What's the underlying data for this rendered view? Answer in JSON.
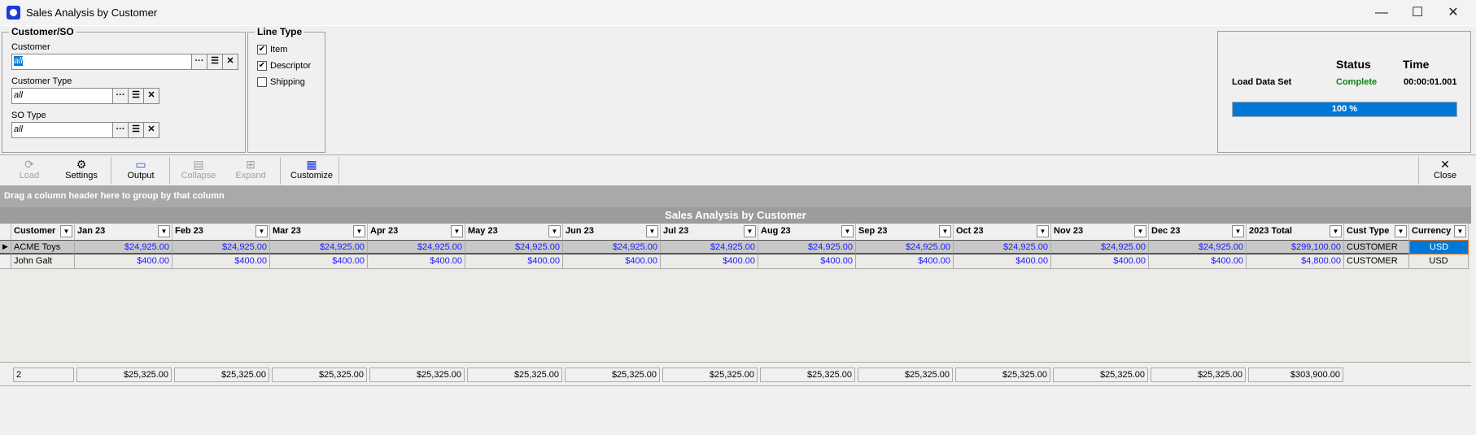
{
  "window": {
    "title": "Sales Analysis by Customer",
    "minimize": "—",
    "maximize": "☐",
    "close": "✕"
  },
  "filters": {
    "group_label": "Customer/SO",
    "customer": {
      "label": "Customer",
      "value": "all"
    },
    "customer_type": {
      "label": "Customer Type",
      "value": "all"
    },
    "so_type": {
      "label": "SO Type",
      "value": "all"
    },
    "browse": "···",
    "list": "☰",
    "clear": "✕"
  },
  "line_type": {
    "label": "Line Type",
    "options": [
      {
        "label": "Item",
        "checked": true
      },
      {
        "label": "Descriptor",
        "checked": true
      },
      {
        "label": "Shipping",
        "checked": false
      }
    ]
  },
  "status": {
    "status_header": "Status",
    "time_header": "Time",
    "task": "Load Data Set",
    "state": "Complete",
    "time": "00:00:01.001",
    "progress_percent": 100,
    "progress_label": "100 %",
    "state_color": "#108010",
    "bar_color": "#0078d7"
  },
  "toolbar": {
    "load": "Load",
    "settings": "Settings",
    "output": "Output",
    "collapse": "Collapse",
    "expand": "Expand",
    "customize": "Customize",
    "close": "Close"
  },
  "grid": {
    "group_hint": "Drag a column header here to group by that column",
    "title": "Sales Analysis by Customer",
    "columns": [
      "Customer",
      "Jan 23",
      "Feb 23",
      "Mar 23",
      "Apr 23",
      "May 23",
      "Jun 23",
      "Jul 23",
      "Aug 23",
      "Sep 23",
      "Oct 23",
      "Nov 23",
      "Dec 23",
      "2023 Total",
      "Cust Type",
      "Currency"
    ],
    "rows": [
      [
        "ACME Toys",
        "$24,925.00",
        "$24,925.00",
        "$24,925.00",
        "$24,925.00",
        "$24,925.00",
        "$24,925.00",
        "$24,925.00",
        "$24,925.00",
        "$24,925.00",
        "$24,925.00",
        "$24,925.00",
        "$24,925.00",
        "$299,100.00",
        "CUSTOMER",
        "USD"
      ],
      [
        "John Galt",
        "$400.00",
        "$400.00",
        "$400.00",
        "$400.00",
        "$400.00",
        "$400.00",
        "$400.00",
        "$400.00",
        "$400.00",
        "$400.00",
        "$400.00",
        "$400.00",
        "$4,800.00",
        "CUSTOMER",
        "USD"
      ]
    ],
    "footer": [
      "2",
      "$25,325.00",
      "$25,325.00",
      "$25,325.00",
      "$25,325.00",
      "$25,325.00",
      "$25,325.00",
      "$25,325.00",
      "$25,325.00",
      "$25,325.00",
      "$25,325.00",
      "$25,325.00",
      "$25,325.00",
      "$303,900.00"
    ]
  }
}
